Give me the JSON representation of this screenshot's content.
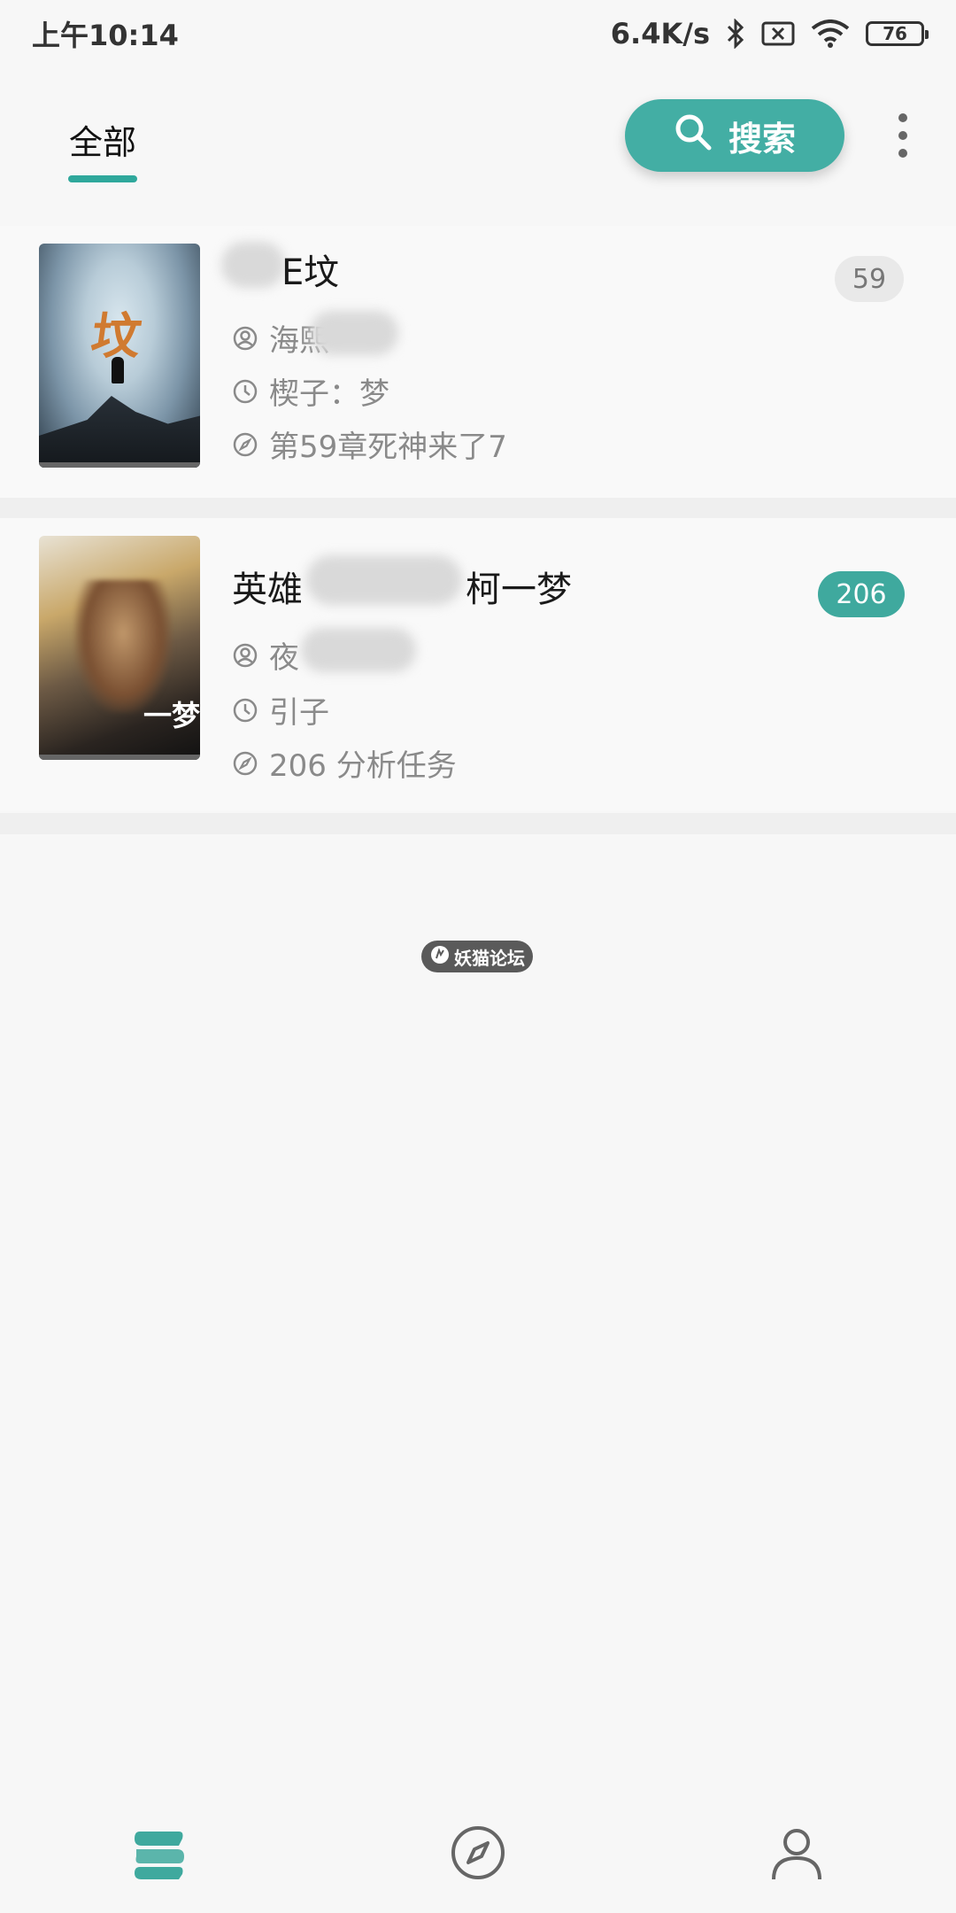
{
  "status_bar": {
    "time": "上午10:14",
    "network_speed": "6.4K/s",
    "battery_level": "76"
  },
  "header": {
    "tab_all": "全部",
    "search_label": "搜索"
  },
  "books": [
    {
      "title_visible": "E坟",
      "author_visible": "海熙",
      "latest_read": "楔子：梦",
      "latest_chapter": "第59章死神来了7",
      "count": "59"
    },
    {
      "title_prefix": "英雄",
      "title_suffix": "柯一梦",
      "author_visible": "夜",
      "latest_read": "引子",
      "latest_chapter": "206 分析任务",
      "count": "206"
    }
  ],
  "watermark": "妖猫论坛",
  "colors": {
    "accent": "#43aea4",
    "badge_active": "#3fa99e",
    "badge_inactive": "#e9e9e9",
    "meta_text": "#8a8a8a"
  },
  "icons": {
    "search": "search-icon",
    "more": "more-vertical-icon",
    "author": "user-circle-icon",
    "time": "clock-icon",
    "chapter": "compass-icon",
    "nav_shelf": "bookshelf-icon",
    "nav_explore": "compass-icon",
    "nav_me": "person-icon"
  }
}
